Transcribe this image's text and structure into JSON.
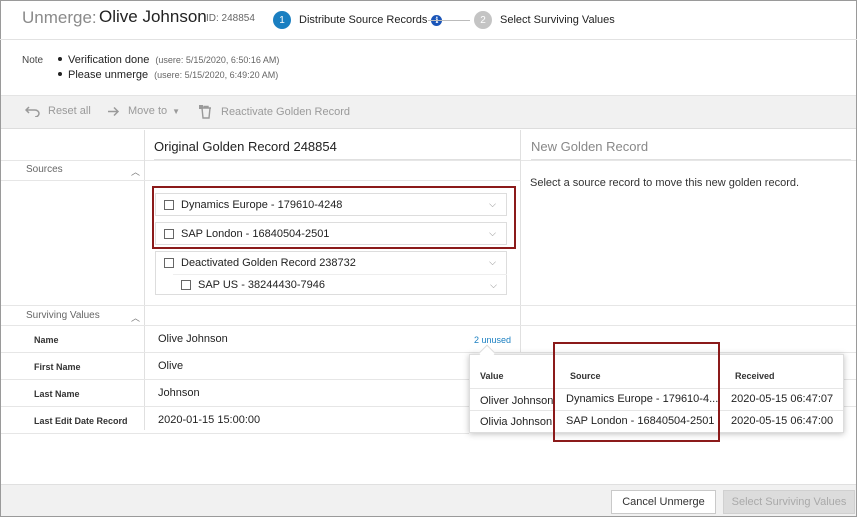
{
  "header": {
    "label": "Unmerge:",
    "name": "Olive Johnson",
    "id_text": "ID: 248854",
    "steps": [
      {
        "number": "1",
        "label": "Distribute Source Records"
      },
      {
        "number": "2",
        "label": "Select Surviving Values"
      }
    ]
  },
  "note": {
    "label": "Note",
    "items": [
      {
        "text": "Verification done",
        "meta": "(usere: 5/15/2020, 6:50:16 AM)"
      },
      {
        "text": "Please unmerge",
        "meta": "(usere: 5/15/2020, 6:49:20 AM)"
      }
    ]
  },
  "toolbar": {
    "reset_all": "Reset all",
    "move_to": "Move to",
    "reactivate": "Reactivate Golden Record"
  },
  "columns": {
    "original": "Original Golden Record 248854",
    "new": "New Golden Record"
  },
  "sections": {
    "sources": "Sources",
    "surviving_values": "Surviving Values"
  },
  "new_record_hint": "Select a source record to move this new golden record.",
  "sources": [
    {
      "label": "Dynamics Europe - 179610-4248"
    },
    {
      "label": "SAP London - 16840504-2501"
    },
    {
      "label": "Deactivated Golden Record 238732"
    },
    {
      "label": "SAP US - 38244430-7946"
    }
  ],
  "surviving_rows": [
    {
      "label": "Name",
      "value": "Olive Johnson"
    },
    {
      "label": "First Name",
      "value": "Olive"
    },
    {
      "label": "Last Name",
      "value": "Johnson"
    },
    {
      "label": "Last Edit Date Record",
      "value": "2020-01-15 15:00:00"
    }
  ],
  "unused_link": "2 unused",
  "popup": {
    "headers": {
      "value": "Value",
      "source": "Source",
      "received": "Received"
    },
    "rows": [
      {
        "value": "Oliver Johnson",
        "source": "Dynamics Europe - 179610-4...",
        "received": "2020-05-15 06:47:07"
      },
      {
        "value": "Olivia Johnson",
        "source": "SAP London - 16840504-2501",
        "received": "2020-05-15 06:47:00"
      }
    ]
  },
  "footer": {
    "cancel": "Cancel Unmerge",
    "select": "Select Surviving Values"
  },
  "colors": {
    "accent": "#1a7fc1",
    "highlight_border": "#8b1a1a",
    "step_inactive": "#c4c4c4"
  }
}
